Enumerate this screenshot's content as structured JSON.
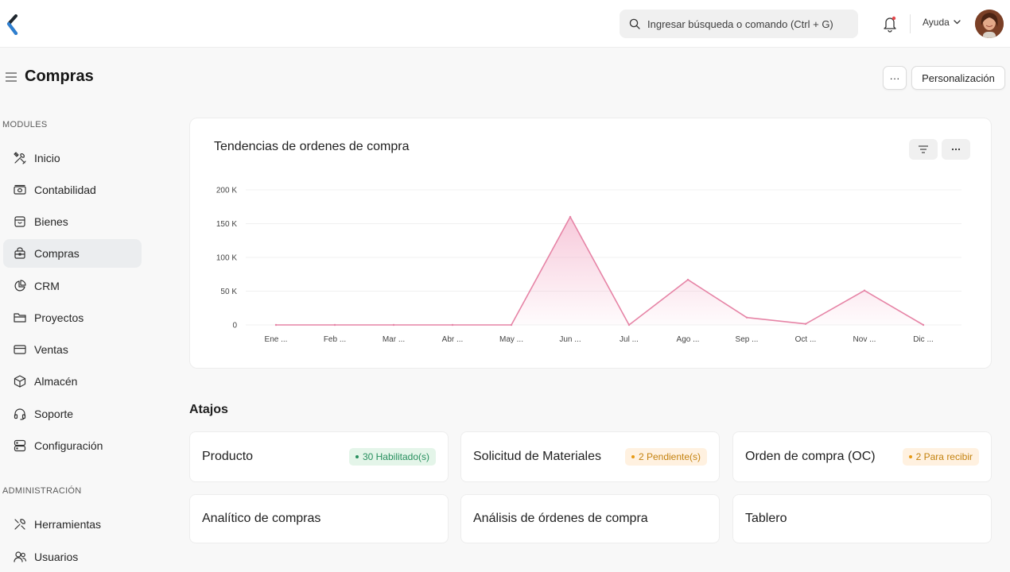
{
  "topbar": {
    "search_placeholder": "Ingresar búsqueda o comando (Ctrl + G)",
    "help_label": "Ayuda"
  },
  "page": {
    "title": "Compras",
    "more_label": "···",
    "customize_label": "Personalización"
  },
  "sidebar": {
    "modules_label": "MODULES",
    "admin_label": "ADMINISTRACIÓN",
    "items": [
      {
        "label": "Inicio",
        "icon": "tools-icon"
      },
      {
        "label": "Contabilidad",
        "icon": "money-icon"
      },
      {
        "label": "Bienes",
        "icon": "box-icon"
      },
      {
        "label": "Compras",
        "icon": "purchase-icon",
        "active": true
      },
      {
        "label": "CRM",
        "icon": "pie-chart-icon"
      },
      {
        "label": "Proyectos",
        "icon": "folder-icon"
      },
      {
        "label": "Ventas",
        "icon": "card-icon"
      },
      {
        "label": "Almacén",
        "icon": "cube-icon"
      },
      {
        "label": "Soporte",
        "icon": "headset-icon"
      },
      {
        "label": "Configuración",
        "icon": "database-icon"
      }
    ],
    "admin_items": [
      {
        "label": "Herramientas",
        "icon": "wrench-icon"
      },
      {
        "label": "Usuarios",
        "icon": "users-icon"
      }
    ]
  },
  "chart_data": {
    "type": "line",
    "title": "Tendencias de ordenes de compra",
    "categories": [
      "Ene ...",
      "Feb ...",
      "Mar ...",
      "Abr ...",
      "May ...",
      "Jun ...",
      "Jul ...",
      "Ago ...",
      "Sep ...",
      "Oct ...",
      "Nov ...",
      "Dic ..."
    ],
    "series": [
      {
        "values": [
          0,
          0,
          0,
          0,
          0,
          160000,
          0,
          67000,
          11000,
          1500,
          51000,
          0
        ]
      }
    ],
    "ylim": [
      0,
      200000
    ],
    "yticks": [
      0,
      50000,
      100000,
      150000,
      200000
    ],
    "ytick_labels": [
      "0",
      "50 K",
      "100 K",
      "150 K",
      "200 K"
    ],
    "grid": true,
    "color": "#e684a6",
    "area_color": "#f5b8cf"
  },
  "shortcuts": {
    "title": "Atajos",
    "items": [
      {
        "label": "Producto",
        "badge": "30 Habilitado(s)",
        "badge_color": "green"
      },
      {
        "label": "Solicitud de Materiales",
        "badge": "2 Pendiente(s)",
        "badge_color": "orange"
      },
      {
        "label": "Orden de compra (OC)",
        "badge": "2 Para recibir",
        "badge_color": "orange"
      },
      {
        "label": "Analítico de compras"
      },
      {
        "label": "Análisis de órdenes de compra"
      },
      {
        "label": "Tablero"
      }
    ]
  }
}
